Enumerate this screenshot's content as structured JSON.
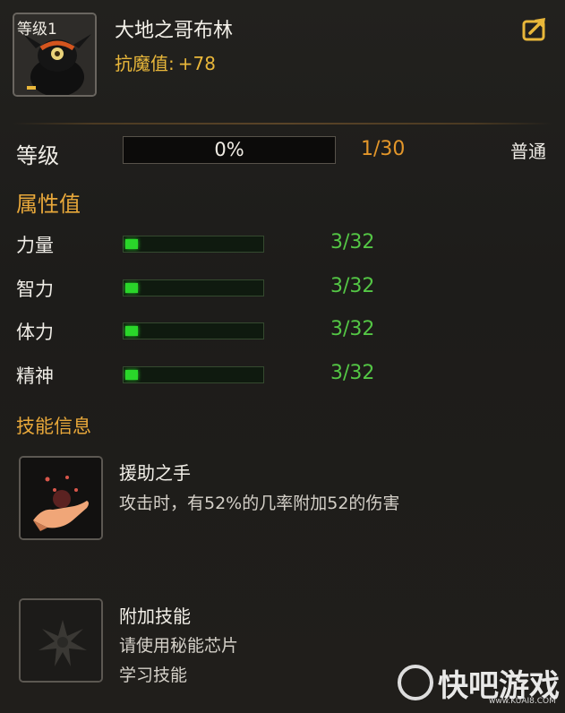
{
  "header": {
    "level_badge": "等级1",
    "name": "大地之哥布林",
    "resist_label": "抗魔值:",
    "resist_value": "+78",
    "share_icon": "share-arrow-icon"
  },
  "level": {
    "label": "等级",
    "progress_text": "0%",
    "progress": 0.0,
    "fraction": "1/30",
    "rank": "普通"
  },
  "attributes": {
    "title": "属性值",
    "items": [
      {
        "label": "力量",
        "value": "3/32",
        "fill": 0.094
      },
      {
        "label": "智力",
        "value": "3/32",
        "fill": 0.094
      },
      {
        "label": "体力",
        "value": "3/32",
        "fill": 0.094
      },
      {
        "label": "精神",
        "value": "3/32",
        "fill": 0.094
      }
    ]
  },
  "skills": {
    "title": "技能信息",
    "items": [
      {
        "name": "援助之手",
        "desc_lines": [
          "攻击时，有52%的几率附加52的伤害"
        ],
        "icon": "helping-hand-icon"
      },
      {
        "name": "附加技能",
        "desc_lines": [
          "请使用秘能芯片",
          "学习技能"
        ],
        "icon": "locked-skill-emblem-icon"
      }
    ]
  },
  "watermark": {
    "text": "快吧游戏",
    "url": "www.KUAI8.COM"
  },
  "colors": {
    "gold": "#e9b73a",
    "orange": "#e3962a",
    "green": "#54c645",
    "bar_green": "#2ad62a"
  }
}
